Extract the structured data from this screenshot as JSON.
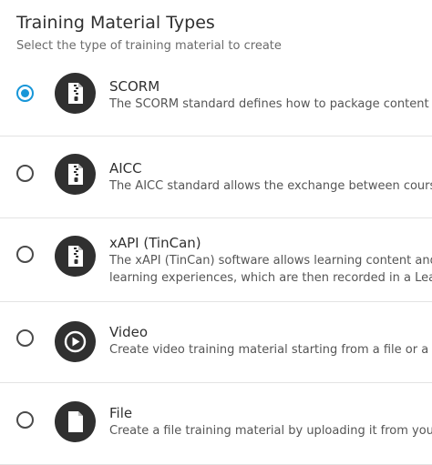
{
  "header": {
    "title": "Training Material Types",
    "subtitle": "Select the type of training material to create"
  },
  "items": [
    {
      "label": "SCORM",
      "description_lines": [
        "The SCORM standard defines how to package content i"
      ],
      "icon": "zip-file-icon",
      "selected": true
    },
    {
      "label": "AICC",
      "description_lines": [
        "The AICC standard allows the exchange between course"
      ],
      "icon": "zip-file-icon",
      "selected": false
    },
    {
      "label": "xAPI (TinCan)",
      "description_lines": [
        "The xAPI (TinCan) software allows learning content and",
        "learning experiences, which are then recorded in a Lear"
      ],
      "icon": "zip-file-icon",
      "selected": false
    },
    {
      "label": "Video",
      "description_lines": [
        "Create video training material starting from a file or a U"
      ],
      "icon": "play-icon",
      "selected": false
    },
    {
      "label": "File",
      "description_lines": [
        "Create a file training material by uploading it from your"
      ],
      "icon": "file-icon",
      "selected": false
    }
  ],
  "colors": {
    "accent": "#1796d8",
    "icon_background": "#303030",
    "divider": "#e3e3e3"
  }
}
